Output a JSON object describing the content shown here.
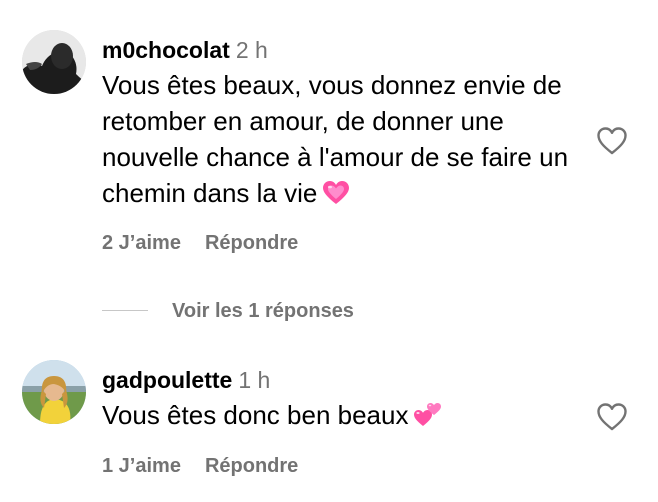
{
  "comments": [
    {
      "username": "m0chocolat",
      "time": "2 h",
      "text": "Vous êtes beaux, vous donnez envie de retomber en amour, de donner une nouvelle chance à l'amour de se faire un chemin dans la vie",
      "emoji": "growing-heart-icon",
      "likes": "2 J’aime",
      "reply_label": "Répondre"
    },
    {
      "username": "gadpoulette",
      "time": "1 h",
      "text": "Vous êtes donc ben beaux",
      "emoji": "two-hearts-icon",
      "likes": "1 J’aime",
      "reply_label": "Répondre"
    }
  ],
  "view_replies": "Voir les 1 réponses",
  "colors": {
    "text": "#000000",
    "muted": "#737373",
    "divider": "#c7c7c7",
    "emoji_pink": "#ff4fa3"
  }
}
